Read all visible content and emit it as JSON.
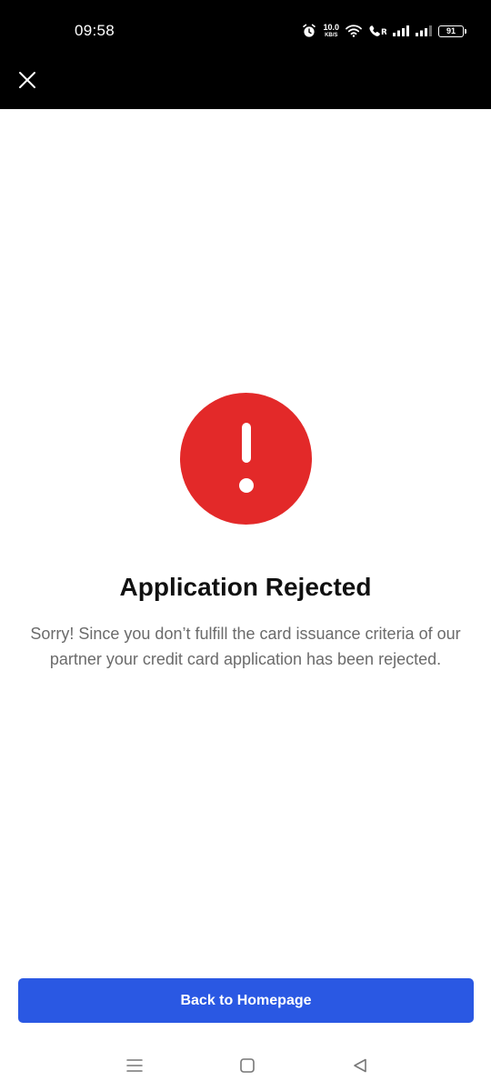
{
  "status_bar": {
    "time": "09:58",
    "net_speed_value": "10.0",
    "net_speed_unit": "KB/S",
    "battery": "91"
  },
  "dialog": {
    "title": "Application Rejected",
    "message": "Sorry! Since you don’t fulfill the card issuance criteria of our partner your credit card application has been rejected.",
    "button_label": "Back to Homepage"
  },
  "colors": {
    "alert_red": "#e32929",
    "primary_blue": "#2a58e3",
    "top_bar": "#000000"
  }
}
